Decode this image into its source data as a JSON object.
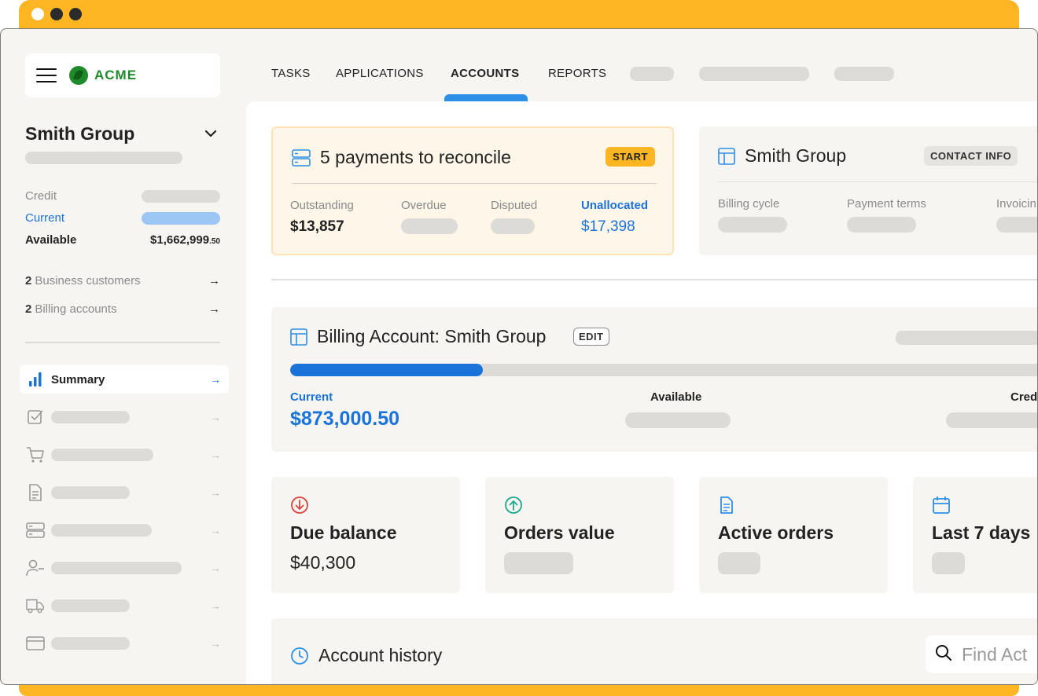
{
  "colors": {
    "accent": "#FDB622",
    "primary_blue": "#1a73d9",
    "brand_green": "#1f8a2a"
  },
  "brand": {
    "name": "ACME"
  },
  "sidebar": {
    "company_name": "Smith Group",
    "credit_label": "Credit",
    "current_label": "Current",
    "available_label": "Available",
    "available_value_main": "$1,662,999",
    "available_value_cents": ".50",
    "links": [
      {
        "count": "2",
        "label": "Business customers"
      },
      {
        "count": "2",
        "label": "Billing accounts"
      }
    ],
    "nav": [
      {
        "label": "Summary",
        "icon": "bar-chart-icon",
        "active": true
      },
      {
        "icon": "checkbox-icon"
      },
      {
        "icon": "cart-icon"
      },
      {
        "icon": "document-icon"
      },
      {
        "icon": "server-icon"
      },
      {
        "icon": "user-minus-icon"
      },
      {
        "icon": "truck-icon"
      },
      {
        "icon": "credit-card-icon"
      }
    ]
  },
  "tabs": [
    {
      "label": "TASKS"
    },
    {
      "label": "APPLICATIONS"
    },
    {
      "label": "ACCOUNTS",
      "active": true
    },
    {
      "label": "REPORTS"
    }
  ],
  "reconcile": {
    "title": "5 payments to reconcile",
    "button": "START",
    "outstanding_label": "Outstanding",
    "outstanding_value": "$13,857",
    "overdue_label": "Overdue",
    "disputed_label": "Disputed",
    "unallocated_label": "Unallocated",
    "unallocated_value": "$17,398"
  },
  "group_card": {
    "title": "Smith Group",
    "button": "CONTACT INFO",
    "billing_cycle_label": "Billing cycle",
    "payment_terms_label": "Payment terms",
    "invoicing_label": "Invoicin"
  },
  "billing_account": {
    "title": "Billing Account: Smith Group",
    "edit_label": "EDIT",
    "progress_fraction": 0.25,
    "current_label": "Current",
    "current_value": "$873,000.50",
    "available_label": "Available",
    "credit_label": "Cred"
  },
  "metrics": [
    {
      "title": "Due balance",
      "value": "$40,300",
      "icon": "arrow-down-circle-icon"
    },
    {
      "title": "Orders value",
      "icon": "arrow-up-circle-icon"
    },
    {
      "title": "Active orders",
      "icon": "document-icon"
    },
    {
      "title": "Last 7 days",
      "icon": "calendar-icon"
    }
  ],
  "history": {
    "title": "Account history",
    "search_placeholder": "Find Act"
  }
}
